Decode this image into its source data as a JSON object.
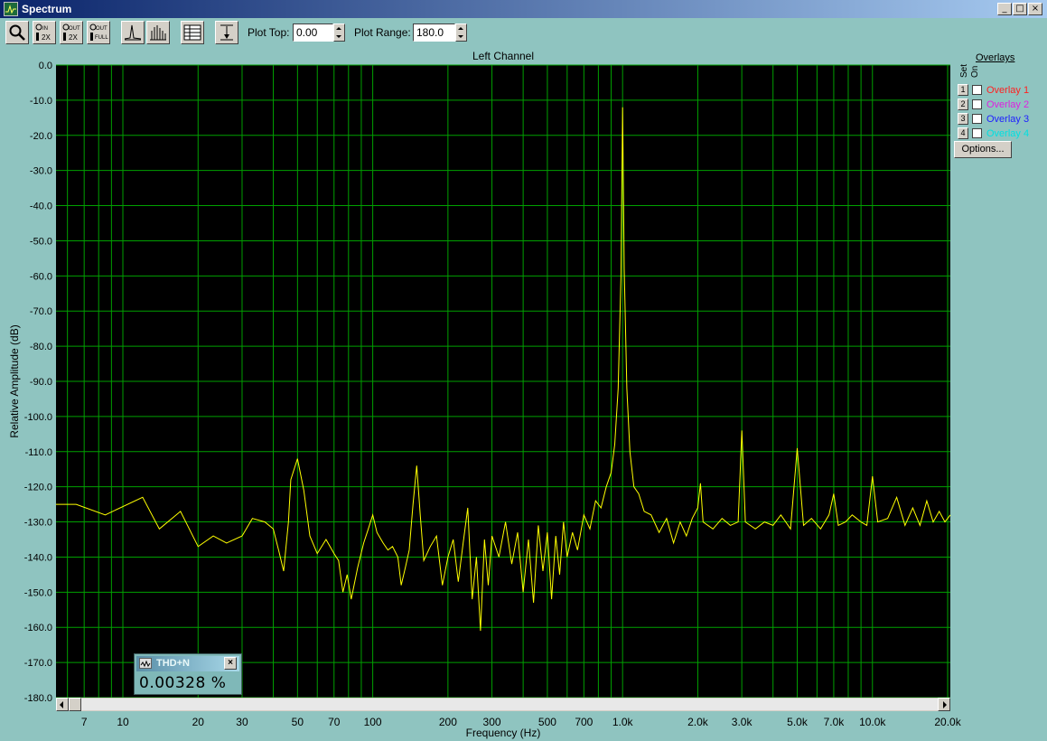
{
  "window": {
    "title": "Spectrum",
    "minimize": "_",
    "maximize": "□",
    "close": "×"
  },
  "toolbar": {
    "buttons": [
      "zoom-icon",
      "zoom-in-2x-icon",
      "zoom-out-2x-icon",
      "zoom-out-full-icon",
      "line-plot-icon",
      "bar-plot-icon",
      "table-view-icon",
      "autoscale-icon"
    ],
    "plot_top_label": "Plot Top:",
    "plot_top_value": "0.00",
    "plot_range_label": "Plot Range:",
    "plot_range_value": "180.0"
  },
  "overlays": {
    "title": "Overlays",
    "col_set": "Set",
    "col_on": "On",
    "items": [
      {
        "num": "1",
        "name": "Overlay 1",
        "color": "#ff2020",
        "checked": false
      },
      {
        "num": "2",
        "name": "Overlay 2",
        "color": "#e020e0",
        "checked": false
      },
      {
        "num": "3",
        "name": "Overlay 3",
        "color": "#2020ff",
        "checked": false
      },
      {
        "num": "4",
        "name": "Overlay 4",
        "color": "#00e0e0",
        "checked": false
      }
    ],
    "options_label": "Options..."
  },
  "meter": {
    "label": "THD+N",
    "value": "0.00328 %",
    "close": "×"
  },
  "chart_data": {
    "type": "line",
    "title": "Left Channel",
    "xlabel": "Frequency (Hz)",
    "ylabel": "Relative Amplitude (dB)",
    "x_scale": "log",
    "xlim": [
      5.4,
      20500
    ],
    "ylim": [
      -180,
      0
    ],
    "grid": true,
    "background": "#000000",
    "grid_color": "#00a000",
    "line_color": "#ffff00",
    "y_ticks": [
      "0.0",
      "-10.0",
      "-20.0",
      "-30.0",
      "-40.0",
      "-50.0",
      "-60.0",
      "-70.0",
      "-80.0",
      "-90.0",
      "-100.0",
      "-110.0",
      "-120.0",
      "-130.0",
      "-140.0",
      "-150.0",
      "-160.0",
      "-170.0",
      "-180.0"
    ],
    "x_tick_labels": [
      {
        "v": 7,
        "t": "7"
      },
      {
        "v": 10,
        "t": "10"
      },
      {
        "v": 20,
        "t": "20"
      },
      {
        "v": 30,
        "t": "30"
      },
      {
        "v": 50,
        "t": "50"
      },
      {
        "v": 70,
        "t": "70"
      },
      {
        "v": 100,
        "t": "100"
      },
      {
        "v": 200,
        "t": "200"
      },
      {
        "v": 300,
        "t": "300"
      },
      {
        "v": 500,
        "t": "500"
      },
      {
        "v": 700,
        "t": "700"
      },
      {
        "v": 1000,
        "t": "1.0k"
      },
      {
        "v": 2000,
        "t": "2.0k"
      },
      {
        "v": 3000,
        "t": "3.0k"
      },
      {
        "v": 5000,
        "t": "5.0k"
      },
      {
        "v": 7000,
        "t": "7.0k"
      },
      {
        "v": 10000,
        "t": "10.0k"
      },
      {
        "v": 20000,
        "t": "20.0k"
      }
    ],
    "series": [
      {
        "values": [
          [
            5.4,
            -125
          ],
          [
            6.5,
            -125
          ],
          [
            8.5,
            -128
          ],
          [
            12,
            -123
          ],
          [
            14,
            -132
          ],
          [
            17,
            -127
          ],
          [
            20,
            -137
          ],
          [
            23,
            -134
          ],
          [
            26,
            -136
          ],
          [
            30,
            -134
          ],
          [
            33,
            -129
          ],
          [
            37,
            -130
          ],
          [
            40,
            -132
          ],
          [
            42,
            -138
          ],
          [
            44,
            -144
          ],
          [
            46,
            -130
          ],
          [
            47,
            -118
          ],
          [
            50,
            -112
          ],
          [
            53,
            -121
          ],
          [
            56,
            -134
          ],
          [
            60,
            -139
          ],
          [
            65,
            -135
          ],
          [
            70,
            -139
          ],
          [
            73,
            -141
          ],
          [
            76,
            -150
          ],
          [
            79,
            -145
          ],
          [
            82,
            -152
          ],
          [
            87,
            -143
          ],
          [
            92,
            -136
          ],
          [
            96,
            -132
          ],
          [
            100,
            -128
          ],
          [
            104,
            -133
          ],
          [
            110,
            -136
          ],
          [
            115,
            -138
          ],
          [
            120,
            -137
          ],
          [
            126,
            -140
          ],
          [
            130,
            -148
          ],
          [
            135,
            -143
          ],
          [
            140,
            -138
          ],
          [
            145,
            -125
          ],
          [
            150,
            -114
          ],
          [
            155,
            -128
          ],
          [
            160,
            -141
          ],
          [
            170,
            -137
          ],
          [
            180,
            -134
          ],
          [
            190,
            -148
          ],
          [
            200,
            -140
          ],
          [
            210,
            -135
          ],
          [
            220,
            -147
          ],
          [
            230,
            -136
          ],
          [
            240,
            -126
          ],
          [
            250,
            -152
          ],
          [
            260,
            -140
          ],
          [
            270,
            -161
          ],
          [
            280,
            -135
          ],
          [
            290,
            -148
          ],
          [
            300,
            -134
          ],
          [
            320,
            -140
          ],
          [
            340,
            -130
          ],
          [
            360,
            -142
          ],
          [
            380,
            -133
          ],
          [
            400,
            -150
          ],
          [
            420,
            -135
          ],
          [
            440,
            -153
          ],
          [
            460,
            -131
          ],
          [
            480,
            -144
          ],
          [
            500,
            -133
          ],
          [
            520,
            -152
          ],
          [
            540,
            -134
          ],
          [
            560,
            -145
          ],
          [
            580,
            -130
          ],
          [
            600,
            -140
          ],
          [
            630,
            -133
          ],
          [
            660,
            -138
          ],
          [
            700,
            -128
          ],
          [
            740,
            -132
          ],
          [
            780,
            -124
          ],
          [
            820,
            -126
          ],
          [
            860,
            -120
          ],
          [
            900,
            -116
          ],
          [
            930,
            -108
          ],
          [
            960,
            -92
          ],
          [
            985,
            -60
          ],
          [
            1000,
            -12
          ],
          [
            1015,
            -58
          ],
          [
            1040,
            -92
          ],
          [
            1070,
            -110
          ],
          [
            1110,
            -120
          ],
          [
            1160,
            -122
          ],
          [
            1220,
            -127
          ],
          [
            1300,
            -128
          ],
          [
            1400,
            -133
          ],
          [
            1500,
            -129
          ],
          [
            1600,
            -136
          ],
          [
            1700,
            -130
          ],
          [
            1800,
            -134
          ],
          [
            1900,
            -129
          ],
          [
            2000,
            -126
          ],
          [
            2050,
            -119
          ],
          [
            2100,
            -130
          ],
          [
            2300,
            -132
          ],
          [
            2500,
            -129
          ],
          [
            2700,
            -131
          ],
          [
            2900,
            -130
          ],
          [
            3000,
            -104
          ],
          [
            3100,
            -130
          ],
          [
            3400,
            -132
          ],
          [
            3700,
            -130
          ],
          [
            4000,
            -131
          ],
          [
            4300,
            -128
          ],
          [
            4700,
            -132
          ],
          [
            5000,
            -109
          ],
          [
            5300,
            -131
          ],
          [
            5700,
            -129
          ],
          [
            6200,
            -132
          ],
          [
            6700,
            -128
          ],
          [
            7000,
            -122
          ],
          [
            7300,
            -131
          ],
          [
            7800,
            -130
          ],
          [
            8300,
            -128
          ],
          [
            9000,
            -130
          ],
          [
            9500,
            -131
          ],
          [
            10000,
            -117
          ],
          [
            10500,
            -130
          ],
          [
            11500,
            -129
          ],
          [
            12500,
            -123
          ],
          [
            13500,
            -131
          ],
          [
            14500,
            -126
          ],
          [
            15500,
            -131
          ],
          [
            16500,
            -124
          ],
          [
            17500,
            -130
          ],
          [
            18500,
            -127
          ],
          [
            19500,
            -130
          ],
          [
            20500,
            -128
          ]
        ]
      }
    ]
  }
}
